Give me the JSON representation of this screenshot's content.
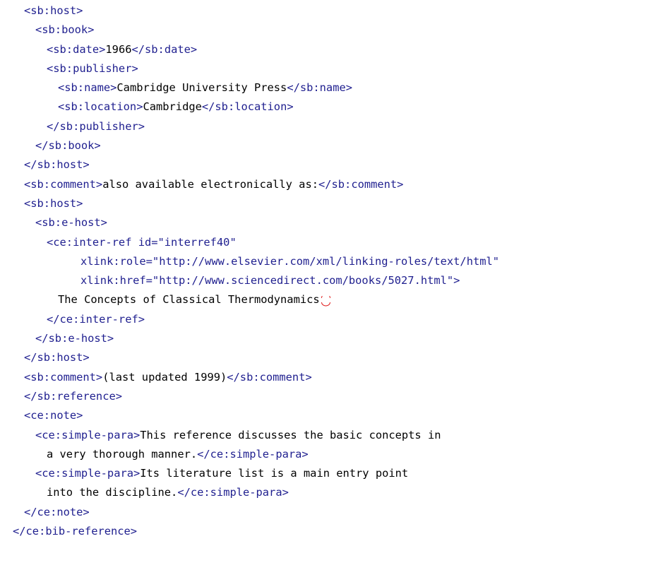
{
  "code": {
    "lines": [
      {
        "indent": 1,
        "tag_open": "<sb:host>",
        "text": "",
        "tag_close": ""
      },
      {
        "indent": 2,
        "tag_open": "<sb:book>",
        "text": "",
        "tag_close": ""
      },
      {
        "indent": 3,
        "tag_open": "<sb:date>",
        "text": "1966",
        "tag_close": "</sb:date>"
      },
      {
        "indent": 3,
        "tag_open": "<sb:publisher>",
        "text": "",
        "tag_close": ""
      },
      {
        "indent": 4,
        "tag_open": "<sb:name>",
        "text": "Cambridge University Press",
        "tag_close": "</sb:name>"
      },
      {
        "indent": 4,
        "tag_open": "<sb:location>",
        "text": "Cambridge",
        "tag_close": "</sb:location>"
      },
      {
        "indent": 3,
        "tag_open": "</sb:publisher>",
        "text": "",
        "tag_close": ""
      },
      {
        "indent": 2,
        "tag_open": "</sb:book>",
        "text": "",
        "tag_close": ""
      },
      {
        "indent": 1,
        "tag_open": "</sb:host>",
        "text": "",
        "tag_close": ""
      },
      {
        "indent": 1,
        "tag_open": "<sb:comment>",
        "text": "also available electronically as:",
        "tag_close": "</sb:comment>"
      },
      {
        "indent": 1,
        "tag_open": "<sb:host>",
        "text": "",
        "tag_close": ""
      },
      {
        "indent": 2,
        "tag_open": "<sb:e-host>",
        "text": "",
        "tag_close": ""
      },
      {
        "indent": 3,
        "tag_open": "<ce:inter-ref id=\"interref40\"",
        "text": "",
        "tag_close": ""
      },
      {
        "indent": 6,
        "tag_open": "xlink:role=\"http://www.elsevier.com/xml/linking-roles/text/html\"",
        "text": "",
        "tag_close": ""
      },
      {
        "indent": 6,
        "tag_open": "xlink:href=\"http://www.sciencedirect.com/books/5027.html\">",
        "text": "",
        "tag_close": ""
      },
      {
        "indent": 4,
        "tag_open": "",
        "text": "The Concepts of Classical Thermodynamics",
        "tag_close": "",
        "wrap_mark": true
      },
      {
        "indent": 3,
        "tag_open": "</ce:inter-ref>",
        "text": "",
        "tag_close": ""
      },
      {
        "indent": 2,
        "tag_open": "</sb:e-host>",
        "text": "",
        "tag_close": ""
      },
      {
        "indent": 1,
        "tag_open": "</sb:host>",
        "text": "",
        "tag_close": ""
      },
      {
        "indent": 1,
        "tag_open": "<sb:comment>",
        "text": "(last updated 1999)",
        "tag_close": "</sb:comment>"
      },
      {
        "indent": 1,
        "tag_open": "</sb:reference>",
        "text": "",
        "tag_close": ""
      },
      {
        "indent": 1,
        "tag_open": "<ce:note>",
        "text": "",
        "tag_close": ""
      },
      {
        "indent": 2,
        "tag_open": "<ce:simple-para>",
        "text": "This reference discusses the basic concepts in",
        "tag_close": ""
      },
      {
        "indent": 3,
        "tag_open": "",
        "text": "a very thorough manner.",
        "tag_close": "</ce:simple-para>"
      },
      {
        "indent": 2,
        "tag_open": "<ce:simple-para>",
        "text": "Its literature list is a main entry point",
        "tag_close": ""
      },
      {
        "indent": 3,
        "tag_open": "",
        "text": "into the discipline.",
        "tag_close": "</ce:simple-para>"
      },
      {
        "indent": 1,
        "tag_open": "</ce:note>",
        "text": "",
        "tag_close": ""
      },
      {
        "indent": 0,
        "tag_open": "</ce:bib-reference>",
        "text": "",
        "tag_close": ""
      }
    ]
  },
  "colors": {
    "tag": "#1f1f8f",
    "text": "#000000",
    "wrap_mark": "#e02020"
  },
  "icons": {
    "line_wrap": "line-wrap-icon"
  }
}
